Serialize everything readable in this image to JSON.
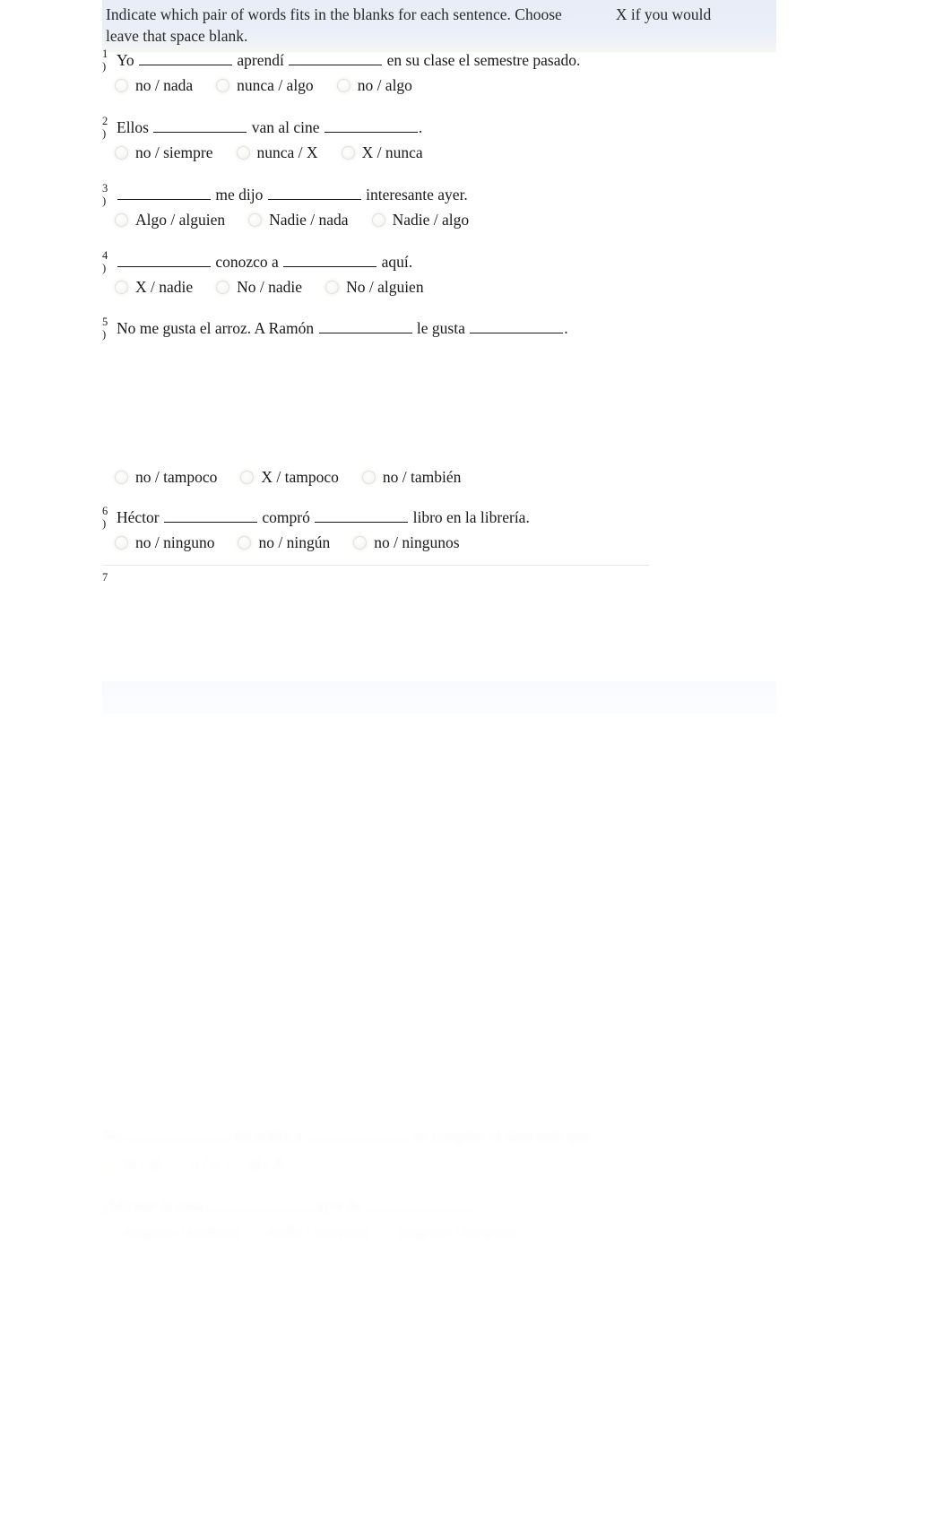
{
  "document": {
    "type": "spanish-grammar-worksheet",
    "accent_banner_color": "#e8edf7",
    "instructions": {
      "line1_a": "Indicate which pair of words fits in the blanks for each sentence. Choose",
      "line1_b": "X if you would",
      "line2": "leave that space blank."
    }
  },
  "questions": [
    {
      "number": "1",
      "paren": ")",
      "stem_parts": [
        "Yo ",
        " aprendí ",
        " en su clase el semestre pasado."
      ],
      "options": [
        "no / nada",
        "nunca / algo",
        "no / algo"
      ]
    },
    {
      "number": "2",
      "paren": ")",
      "stem_parts": [
        "Ellos ",
        " van al cine ",
        "."
      ],
      "options": [
        "no / siempre",
        "nunca / X",
        "X / nunca"
      ]
    },
    {
      "number": "3",
      "paren": ")",
      "stem_parts": [
        "",
        " me dijo ",
        " interesante ayer."
      ],
      "options": [
        "Algo / alguien",
        "Nadie / nada",
        "Nadie / algo"
      ]
    },
    {
      "number": "4",
      "paren": ")",
      "stem_parts": [
        "",
        " conozco a ",
        " aquí."
      ],
      "options": [
        "X / nadie",
        "No / nadie",
        "No / alguien"
      ]
    },
    {
      "number": "5",
      "paren": ")",
      "stem_parts": [
        "No me gusta el arroz. A Ramón ",
        " le gusta ",
        "."
      ],
      "options": [
        "no / tampoco",
        "X / tampoco",
        "no / también"
      ]
    },
    {
      "number": "6",
      "paren": ")",
      "stem_parts": [
        "Héctor ",
        " compró ",
        " libro en la librería."
      ],
      "options": [
        "no / ninguno",
        "no / ningún",
        "no / ningunos"
      ]
    },
    {
      "number": "7",
      "paren": "",
      "stem_parts": [
        "",
        "",
        ""
      ],
      "options": []
    }
  ],
  "ghost_section": {
    "visible": true,
    "note": "second banner and additional faded question rows, illegible in the capture",
    "rows": 6
  }
}
